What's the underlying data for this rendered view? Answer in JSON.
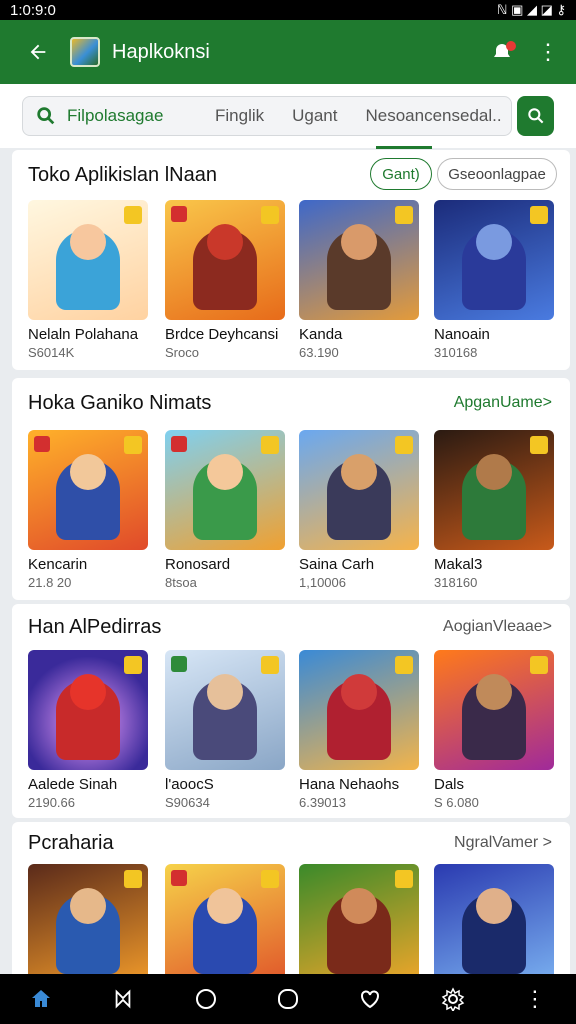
{
  "status": {
    "time": "1:0:9:0",
    "icons": "ℕ ▣ ◢ ◪ ⚷"
  },
  "appbar": {
    "title": "Haplkoknsi"
  },
  "search": {
    "label": "Filpolasagae",
    "tabs": [
      "Finglik",
      "Ugant",
      "Nesoancensedal.."
    ]
  },
  "sections": [
    {
      "title": "Toko Aplikislan lNaan",
      "chips": [
        "Gant)",
        "Gseoonlagpae"
      ],
      "cards": [
        {
          "name": "Nelaln Polahana",
          "price": "S6014K"
        },
        {
          "name": "Brdce Deyhcansi",
          "price": "Sroco"
        },
        {
          "name": "Kanda",
          "price": "63.190"
        },
        {
          "name": "Nanoain",
          "price": "310168"
        }
      ]
    },
    {
      "title": "Hoka Ganiko Nimats",
      "link": "ApganUame>",
      "cards": [
        {
          "name": "Kencarin",
          "price": "21.8 20"
        },
        {
          "name": "Ronosard",
          "price": "8tsoa"
        },
        {
          "name": "Saina Carh",
          "price": "1,10006"
        },
        {
          "name": "Makal3",
          "price": "318160"
        }
      ]
    },
    {
      "title": "Han AlPedirras",
      "link": "AogianVleaae>",
      "cards": [
        {
          "name": "Aalede Sinah",
          "price": "2190.66"
        },
        {
          "name": "l'aoocS",
          "price": "S90634"
        },
        {
          "name": "Hana Nehaohs",
          "price": "6.39013"
        },
        {
          "name": "Dals",
          "price": "S 6.080"
        }
      ]
    },
    {
      "title": "Pcraharia",
      "link": "NgralVamer >",
      "cards": [
        {},
        {},
        {},
        {}
      ]
    }
  ],
  "colors": {
    "primary": "#1f7a2f",
    "badge": "#f3c623"
  }
}
